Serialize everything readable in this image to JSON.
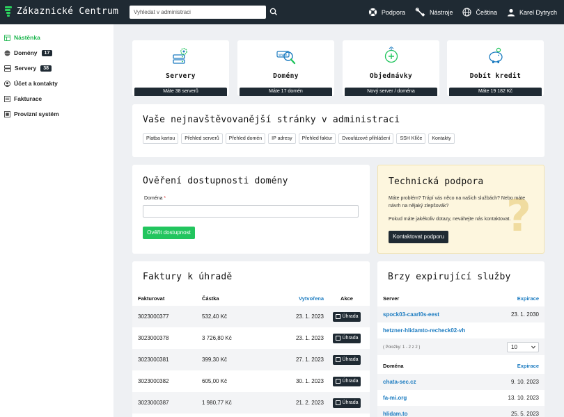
{
  "header": {
    "title": "Zákaznické Centrum",
    "search_placeholder": "Vyhledat v administraci",
    "nav": [
      {
        "label": "Podpora",
        "icon": "lifebuoy-icon"
      },
      {
        "label": "Nástroje",
        "icon": "tools-icon"
      },
      {
        "label": "Čeština",
        "icon": "globe-icon"
      },
      {
        "label": "Karel Dytrych",
        "icon": "user-icon"
      }
    ]
  },
  "sidebar": {
    "items": [
      {
        "label": "Nástěnka",
        "icon": "dashboard-icon",
        "active": true
      },
      {
        "label": "Domény",
        "icon": "globe-icon",
        "badge": "17"
      },
      {
        "label": "Servery",
        "icon": "server-icon",
        "badge": "38"
      },
      {
        "label": "Účet a kontakty",
        "icon": "user-circle-icon"
      },
      {
        "label": "Fakturace",
        "icon": "invoice-icon"
      },
      {
        "label": "Provizní systém",
        "icon": "commission-icon"
      }
    ]
  },
  "tiles": [
    {
      "label": "Servery",
      "footer": "Máte 38 serverů",
      "icon": "server-gear-icon"
    },
    {
      "label": "Domény",
      "footer": "Máte 17 domén",
      "icon": "domain-search-icon"
    },
    {
      "label": "Objednávky",
      "footer": "Nový server / doména",
      "icon": "order-add-icon"
    },
    {
      "label": "Dobít kredit",
      "footer": "Máte 19 182 Kč",
      "icon": "piggy-bank-icon"
    }
  ],
  "quick": {
    "title": "Vaše nejnavštěvovanější stránky v administraci",
    "links": [
      "Platba kartou",
      "Přehled serverů",
      "Přehled domén",
      "IP adresy",
      "Přehled faktur",
      "Dvoufázové přihlášení",
      "SSH Klíče",
      "Kontakty"
    ]
  },
  "domain_check": {
    "title": "Ověření dostupnosti domény",
    "field_label": "Doména",
    "required_mark": "*",
    "input_value": "",
    "button": "Ověřit dostupnost"
  },
  "support": {
    "title": "Technická podpora",
    "text1": "Máte problém? Trápí vás něco na našich službách? Nebo máte návrh na nějaký zlepšovák?",
    "text2": "Pokud máte jakékoliv dotazy, neváhejte nás kontaktovat.",
    "button": "Kontaktovat podporu",
    "decor": "?"
  },
  "invoices": {
    "title": "Faktury k úhradě",
    "columns": [
      "Fakturovat",
      "Částka",
      "Vytvořena",
      "Akce"
    ],
    "pay_label": "Úhrada",
    "rows": [
      {
        "number": "3023000377",
        "amount": "532,40 Kč",
        "created": "23. 1. 2023"
      },
      {
        "number": "3023000378",
        "amount": "3 726,80 Kč",
        "created": "23. 1. 2023"
      },
      {
        "number": "3023000381",
        "amount": "399,30 Kč",
        "created": "27. 1. 2023"
      },
      {
        "number": "3023000382",
        "amount": "605,00 Kč",
        "created": "30. 1. 2023"
      },
      {
        "number": "3023000387",
        "amount": "1 980,77 Kč",
        "created": "21. 2. 2023"
      }
    ]
  },
  "expiring": {
    "title": "Brzy expirující služby",
    "servers_header": "Server",
    "expiry_header": "Expirace",
    "servers": [
      {
        "name": "spock03-caarl0s-eest",
        "expiry": "23. 1. 2030"
      },
      {
        "name": "hetzner-hlidamto-recheck02-vh",
        "expiry": ""
      }
    ],
    "pager_info": "( Položky: 1 - 2 z 2 )",
    "page_size": "10",
    "domains_header": "Doména",
    "domains": [
      {
        "name": "chata-sec.cz",
        "expiry": "9. 10. 2023"
      },
      {
        "name": "fa-mi.org",
        "expiry": "13. 10. 2023"
      },
      {
        "name": "hlidam.to",
        "expiry": "25. 5. 2023"
      }
    ]
  }
}
